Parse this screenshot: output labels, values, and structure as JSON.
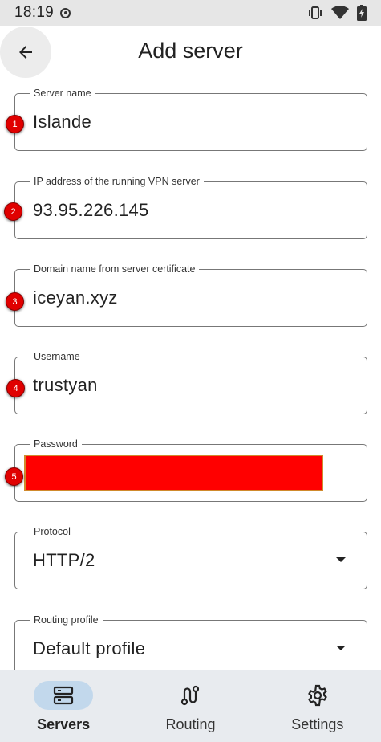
{
  "status": {
    "time": "18:19"
  },
  "header": {
    "title": "Add server"
  },
  "form": {
    "server_name": {
      "label": "Server name",
      "value": "Islande",
      "marker": "1"
    },
    "ip_address": {
      "label": "IP address of the running VPN server",
      "value": "93.95.226.145",
      "marker": "2"
    },
    "domain": {
      "label": "Domain name from server certificate",
      "value": "iceyan.xyz",
      "marker": "3"
    },
    "username": {
      "label": "Username",
      "value": "trustyan",
      "marker": "4"
    },
    "password": {
      "label": "Password",
      "marker": "5"
    },
    "protocol": {
      "label": "Protocol",
      "value": "HTTP/2"
    },
    "routing_profile": {
      "label": "Routing profile",
      "value": "Default profile"
    }
  },
  "nav": {
    "items": [
      {
        "label": "Servers",
        "icon": "servers-icon",
        "active": true
      },
      {
        "label": "Routing",
        "icon": "routing-icon",
        "active": false
      },
      {
        "label": "Settings",
        "icon": "settings-gear-icon",
        "active": false
      }
    ]
  },
  "colors": {
    "accent": "#c2d8ec",
    "marker": "#e00000",
    "redaction": "#ff0000",
    "navbar_bg": "#e8ebef"
  }
}
